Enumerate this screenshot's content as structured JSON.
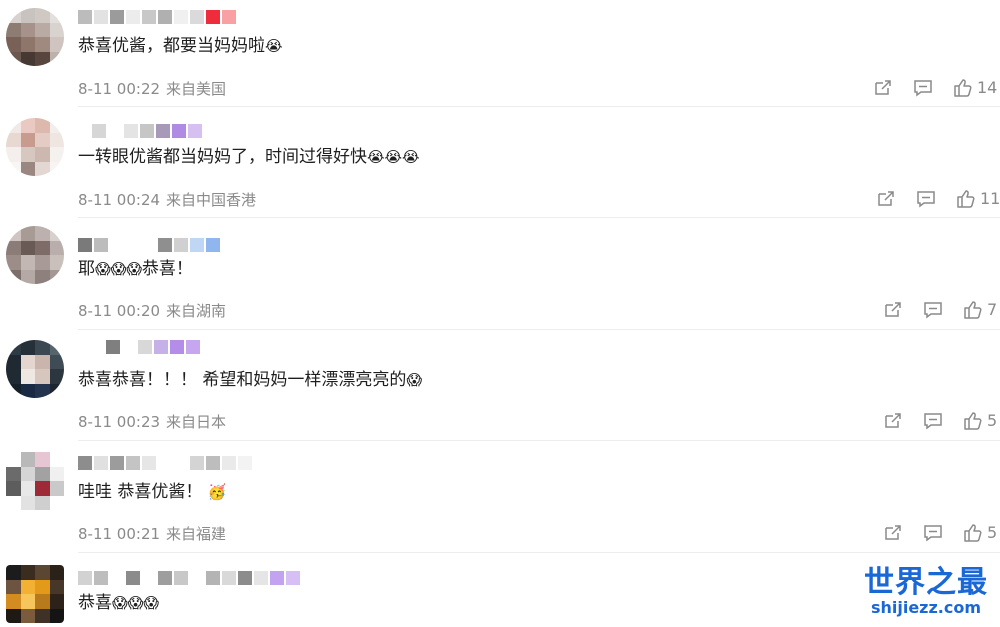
{
  "comments": [
    {
      "text": "恭喜优酱，都要当妈妈啦",
      "emoji": "😭",
      "time": "8-11 00:22",
      "location": "来自美国",
      "likes": "14"
    },
    {
      "text": "一转眼优酱都当妈妈了，时间过得好快",
      "emoji": "😭😭😭",
      "time": "8-11 00:24",
      "location": "来自中国香港",
      "likes": "11"
    },
    {
      "text": "耶",
      "emoji": "😱😱😱",
      "text_after": "恭喜！",
      "time": "8-11 00:20",
      "location": "来自湖南",
      "likes": "7"
    },
    {
      "text": "恭喜恭喜！！！ 希望和妈妈一样漂漂亮亮的",
      "emoji": "😱",
      "time": "8-11 00:23",
      "location": "来自日本",
      "likes": "5"
    },
    {
      "text": "哇哇 恭喜优酱！",
      "emoji": "🥳",
      "time": "8-11 00:21",
      "location": "来自福建",
      "likes": "5"
    },
    {
      "text": "恭喜",
      "emoji": "😱😱😱",
      "time": "",
      "location": "",
      "likes": ""
    }
  ],
  "icons": {
    "share": "share-icon",
    "comment": "comment-icon",
    "like": "thumbs-up-icon"
  },
  "watermark": {
    "title": "世界之最",
    "subtitle": "shijiezz.com"
  },
  "colors": {
    "accent": "#1a67d6",
    "meta": "#8a8a8a"
  }
}
